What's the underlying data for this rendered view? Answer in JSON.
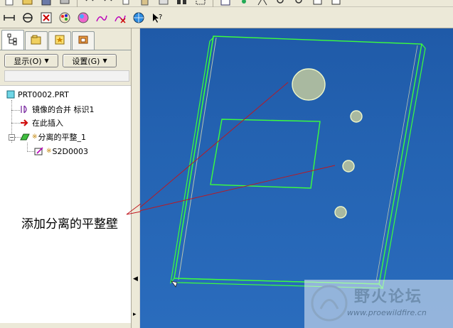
{
  "toolbar": {
    "row2_icons": [
      "measure-icon",
      "section-icon",
      "close-window-icon",
      "palette-icon",
      "scene-icon",
      "sketch-icon",
      "delete-sketch-icon",
      "globe-icon",
      "whats-this-icon"
    ]
  },
  "panel": {
    "tabs": [
      "model-tree-icon",
      "folder-icon",
      "favorites-icon",
      "connections-icon"
    ],
    "show_label": "显示(O)",
    "settings_label": "设置(G)"
  },
  "tree": {
    "nodes": [
      {
        "label": "PRT0002.PRT"
      },
      {
        "label": "镜像的合并 标识1"
      },
      {
        "label": "在此插入"
      },
      {
        "label": "分离的平整_1"
      },
      {
        "label": "S2D0003"
      }
    ]
  },
  "callout": {
    "text": "添加分离的平整壁"
  },
  "watermark": {
    "title": "野火论坛",
    "url": "www.proewildfire.cn"
  },
  "colors": {
    "viewport_bg": "#2463b2",
    "edge": "#3cff3c",
    "hole_fill": "#a9b9a0",
    "leader": "#c0161d"
  }
}
